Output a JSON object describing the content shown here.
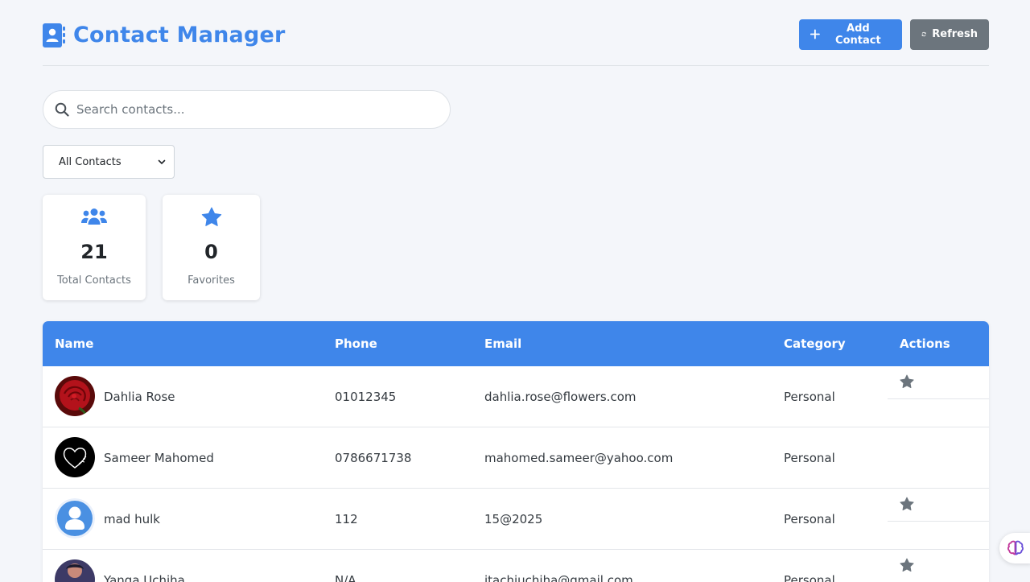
{
  "app": {
    "title": "Contact Manager",
    "brand_color": "#3f86ea"
  },
  "header": {
    "add_label": "Add Contact",
    "refresh_label": "Refresh"
  },
  "search": {
    "placeholder": "Search contacts..."
  },
  "filter": {
    "selected": "All Contacts"
  },
  "stats": {
    "total": {
      "value": "21",
      "label": "Total Contacts",
      "icon": "users-icon"
    },
    "favorites": {
      "value": "0",
      "label": "Favorites",
      "icon": "star-icon"
    }
  },
  "table": {
    "columns": [
      "Name",
      "Phone",
      "Email",
      "Category",
      "Actions"
    ],
    "rows": [
      {
        "name": "Dahlia Rose",
        "phone": "01012345",
        "email": "dahlia.rose@flowers.com",
        "category": "Personal",
        "avatar": "rose-photo"
      },
      {
        "name": "Sameer Mahomed",
        "phone": "0786671738",
        "email": "mahomed.sameer@yahoo.com",
        "category": "Personal",
        "avatar": "heart-drawing"
      },
      {
        "name": "mad hulk",
        "phone": "112",
        "email": "15@2025",
        "category": "Personal",
        "avatar": "default-user"
      },
      {
        "name": "Yanga Uchiha",
        "phone": "N/A",
        "email": "itachiuchiha@gmail.com",
        "category": "Personal",
        "avatar": "anime-photo"
      }
    ]
  }
}
